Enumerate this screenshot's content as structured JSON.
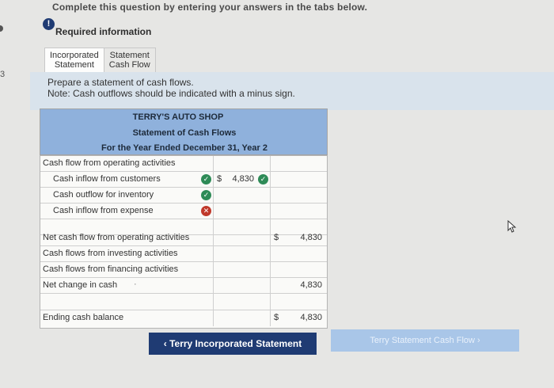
{
  "page": {
    "top_instruction": "Complete this question by entering your answers in the tabs below.",
    "left_marker": "3",
    "required_info": "Required information"
  },
  "tabs": [
    {
      "line1": "Incorporated",
      "line2": "Statement"
    },
    {
      "line1": "Statement",
      "line2": "Cash Flow"
    }
  ],
  "prompt": {
    "line1": "Prepare a statement of cash flows.",
    "line2": "Note: Cash outflows should be indicated with a minus sign."
  },
  "statement": {
    "company": "TERRY'S AUTO SHOP",
    "title": "Statement of Cash Flows",
    "period": "For the Year Ended December 31, Year 2"
  },
  "rows": [
    {
      "label": "Cash flow from operating activities",
      "indent": 0
    },
    {
      "label": "Cash inflow from customers",
      "indent": 1,
      "status": "correct",
      "dollar": "$",
      "amount": "4,830",
      "amount_status": "correct"
    },
    {
      "label": "Cash outflow for inventory",
      "indent": 1,
      "status": "correct"
    },
    {
      "label": "Cash inflow from expense",
      "indent": 1,
      "status": "incorrect"
    },
    {
      "label": "",
      "indent": 0
    },
    {
      "label": "Net cash flow from operating activities",
      "indent": 0,
      "dollar": "$",
      "total": "4,830"
    },
    {
      "label": "Cash flows from investing activities",
      "indent": 0
    },
    {
      "label": "Cash flows from financing activities",
      "indent": 0
    },
    {
      "label": "Net change in cash",
      "indent": 0,
      "total": "4,830"
    },
    {
      "label": "",
      "indent": 0
    },
    {
      "label": "Ending cash balance",
      "indent": 0,
      "dollar": "$",
      "total": "4,830"
    }
  ],
  "buttons": {
    "prev_label": "‹  Terry Incorporated Statement",
    "next_label": "Terry Statement Cash Flow  ›"
  },
  "colors": {
    "header_blue": "#8fb1dc",
    "nav_dark": "#1f3b73",
    "nav_light": "#a9c6e8",
    "correct": "#2e8b57",
    "incorrect": "#c0392b"
  }
}
